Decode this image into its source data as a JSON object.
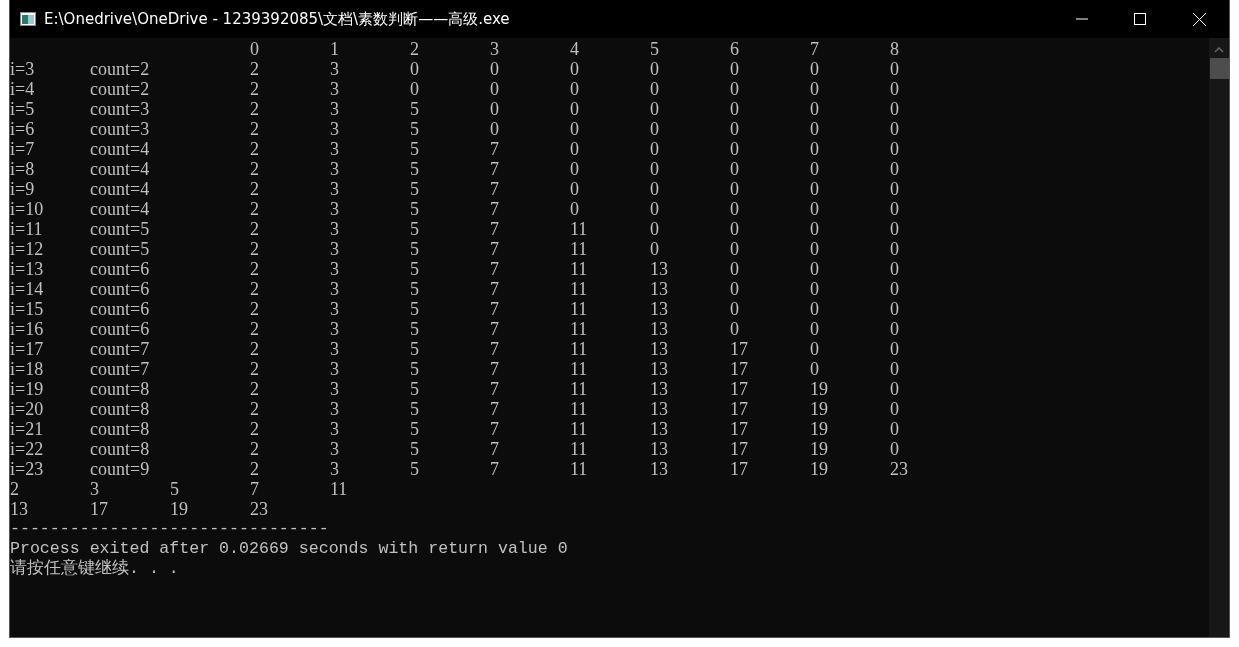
{
  "window": {
    "title": "E:\\Onedrive\\OneDrive - 1239392085\\文档\\素数判断——高级.exe"
  },
  "console": {
    "header": [
      "0",
      "1",
      "2",
      "3",
      "4",
      "5",
      "6",
      "7",
      "8"
    ],
    "rows": [
      {
        "label": "i=3",
        "count": "count=2",
        "values": [
          "2",
          "3",
          "0",
          "0",
          "0",
          "0",
          "0",
          "0",
          "0"
        ]
      },
      {
        "label": "i=4",
        "count": "count=2",
        "values": [
          "2",
          "3",
          "0",
          "0",
          "0",
          "0",
          "0",
          "0",
          "0"
        ]
      },
      {
        "label": "i=5",
        "count": "count=3",
        "values": [
          "2",
          "3",
          "5",
          "0",
          "0",
          "0",
          "0",
          "0",
          "0"
        ]
      },
      {
        "label": "i=6",
        "count": "count=3",
        "values": [
          "2",
          "3",
          "5",
          "0",
          "0",
          "0",
          "0",
          "0",
          "0"
        ]
      },
      {
        "label": "i=7",
        "count": "count=4",
        "values": [
          "2",
          "3",
          "5",
          "7",
          "0",
          "0",
          "0",
          "0",
          "0"
        ]
      },
      {
        "label": "i=8",
        "count": "count=4",
        "values": [
          "2",
          "3",
          "5",
          "7",
          "0",
          "0",
          "0",
          "0",
          "0"
        ]
      },
      {
        "label": "i=9",
        "count": "count=4",
        "values": [
          "2",
          "3",
          "5",
          "7",
          "0",
          "0",
          "0",
          "0",
          "0"
        ]
      },
      {
        "label": "i=10",
        "count": "count=4",
        "values": [
          "2",
          "3",
          "5",
          "7",
          "0",
          "0",
          "0",
          "0",
          "0"
        ]
      },
      {
        "label": "i=11",
        "count": "count=5",
        "values": [
          "2",
          "3",
          "5",
          "7",
          "11",
          "0",
          "0",
          "0",
          "0"
        ]
      },
      {
        "label": "i=12",
        "count": "count=5",
        "values": [
          "2",
          "3",
          "5",
          "7",
          "11",
          "0",
          "0",
          "0",
          "0"
        ]
      },
      {
        "label": "i=13",
        "count": "count=6",
        "values": [
          "2",
          "3",
          "5",
          "7",
          "11",
          "13",
          "0",
          "0",
          "0"
        ]
      },
      {
        "label": "i=14",
        "count": "count=6",
        "values": [
          "2",
          "3",
          "5",
          "7",
          "11",
          "13",
          "0",
          "0",
          "0"
        ]
      },
      {
        "label": "i=15",
        "count": "count=6",
        "values": [
          "2",
          "3",
          "5",
          "7",
          "11",
          "13",
          "0",
          "0",
          "0"
        ]
      },
      {
        "label": "i=16",
        "count": "count=6",
        "values": [
          "2",
          "3",
          "5",
          "7",
          "11",
          "13",
          "0",
          "0",
          "0"
        ]
      },
      {
        "label": "i=17",
        "count": "count=7",
        "values": [
          "2",
          "3",
          "5",
          "7",
          "11",
          "13",
          "17",
          "0",
          "0"
        ]
      },
      {
        "label": "i=18",
        "count": "count=7",
        "values": [
          "2",
          "3",
          "5",
          "7",
          "11",
          "13",
          "17",
          "0",
          "0"
        ]
      },
      {
        "label": "i=19",
        "count": "count=8",
        "values": [
          "2",
          "3",
          "5",
          "7",
          "11",
          "13",
          "17",
          "19",
          "0"
        ]
      },
      {
        "label": "i=20",
        "count": "count=8",
        "values": [
          "2",
          "3",
          "5",
          "7",
          "11",
          "13",
          "17",
          "19",
          "0"
        ]
      },
      {
        "label": "i=21",
        "count": "count=8",
        "values": [
          "2",
          "3",
          "5",
          "7",
          "11",
          "13",
          "17",
          "19",
          "0"
        ]
      },
      {
        "label": "i=22",
        "count": "count=8",
        "values": [
          "2",
          "3",
          "5",
          "7",
          "11",
          "13",
          "17",
          "19",
          "0"
        ]
      },
      {
        "label": "i=23",
        "count": "count=9",
        "values": [
          "2",
          "3",
          "5",
          "7",
          "11",
          "13",
          "17",
          "19",
          "23"
        ]
      }
    ],
    "primes": [
      [
        "2",
        "3",
        "5",
        "7",
        "11"
      ],
      [
        "13",
        "17",
        "19",
        "23"
      ]
    ],
    "separator": "--------------------------------",
    "messages": [
      "Process exited after 0.02669 seconds with return value 0",
      "请按任意键继续. . ."
    ]
  }
}
